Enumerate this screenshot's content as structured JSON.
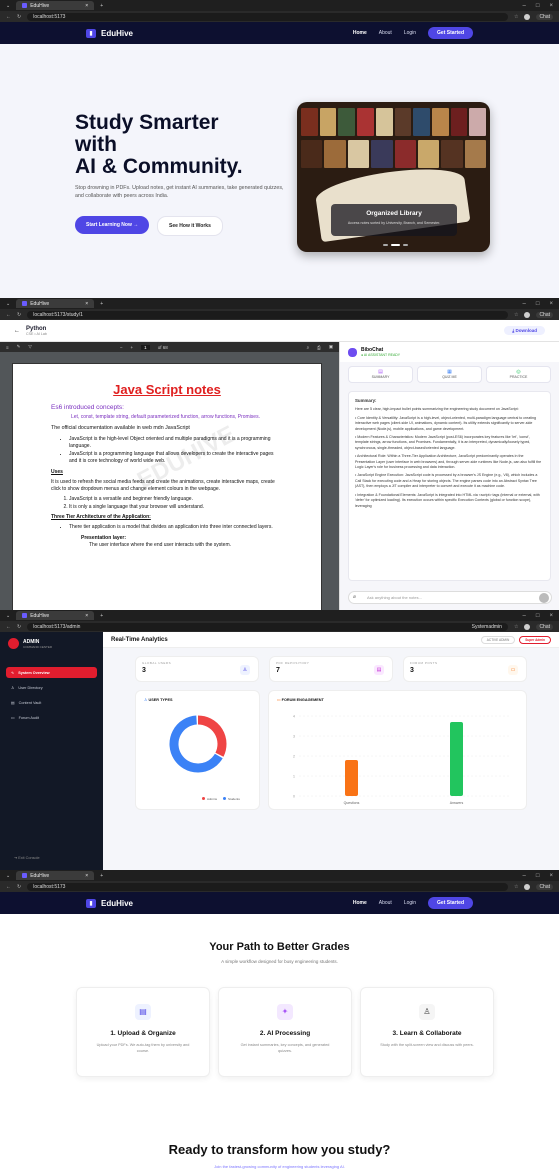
{
  "browser": {
    "tab_title": "EduHive",
    "url_home": "localhost:5173",
    "url_study": "localhost:5173/study/1",
    "url_admin": "localhost:5173/admin",
    "chat_label": "Chat",
    "new_tab": "+"
  },
  "nav": {
    "brand": "EduHive",
    "home": "Home",
    "about": "About",
    "login": "Login",
    "get_started": "Get Started"
  },
  "hero": {
    "title_line1": "Study Smarter",
    "title_line2": "with",
    "title_line3": "AI & Community.",
    "subtitle": "Stop drowning in PDFs. Upload notes, get instant AI summaries, take generated quizzes, and collaborate with peers across India.",
    "cta_primary": "Start Learning Now →",
    "cta_secondary": "See How it Works",
    "card_title": "Organized Library",
    "card_sub": "Access notes sorted by University, Branch, and Semester."
  },
  "study": {
    "doc_title": "Python",
    "doc_meta": "CSE • AI Lab",
    "download": "Download",
    "pdf_page": "1",
    "pdf_total": "of 68",
    "page": {
      "heading": "Java Script notes",
      "es6": "Es6 introduced concepts:",
      "es6_items": "Let, const, template string, default parameterized function, arrow functions, Promises.",
      "doc_line": "The official documentation available in web mdn JavaScript",
      "b1": "JavaScript is the high-level Object oriented and multiple paradigms and it is a programming language.",
      "b2": "JavaScript is a programming language that allows developers to create the interactive pages and it is core technology of world wide web.",
      "uses": "Uses",
      "uses_text": "It is used to refresh the social media feeds and create the animations, create interactive maps, create click to show dropdown menus and change element colours in the webpage.",
      "o1": "JavaScript is a versatile and beginner friendly language.",
      "o2": "It is only a single language that your browser will understand.",
      "arch": "Three Tier Architecture of the Application:",
      "arch1": "There tier application is a model that divides an application into three inter connected layers.",
      "arch2": "Presentation layer:",
      "arch3": "The user interface where the end user interacts with the system."
    },
    "chat": {
      "name": "BiboChat",
      "status": "● AI ASSISTANT READY",
      "mode1": "SUMMARY",
      "mode2": "QUIZ ME",
      "mode3": "PRACTICE",
      "summary_title": "Summary:",
      "intro": "Here are 5 clear, high-impact bullet points summarizing the engineering study document on JavaScript:",
      "p1": "• Core Identity & Versatility: JavaScript is a high-level, object-oriented, multi-paradigm language central to creating interactive web pages (client-side UI, animations, dynamic content). Its utility extends significantly to server-side development (Node.js), mobile applications, and game development.",
      "p2": "• Modern Features & Characteristics: Modern JavaScript (post-ES6) incorporates key features like 'let', 'const', template strings, arrow functions, and Promises. Fundamentally, it is an interpreted, dynamically/loosely typed, synchronous, single-threaded, object-based/oriented language.",
      "p3": "• Architectural Role: Within a Three-Tier Application Architecture, JavaScript predominantly operates in the Presentation Layer (user interface in web browsers) and, through server-side runtimes like Node.js, can also fulfill the Logic Layer's role for business processing and data interaction.",
      "p4": "• JavaScript Engine Execution: JavaScript code is processed by a browser's JS Engine (e.g., V8), which includes a Call Stack for executing code and a Heap for storing objects. The engine parses code into an Abstract Syntax Tree (AST), then employs a JIT compiler and interpreter to convert and execute it as machine code.",
      "p5": "• Integration & Foundational Elements: JavaScript is integrated into HTML via <script> tags (internal or external, with 'defer' for optimized loading). Its execution occurs within specific Execution Contexts (global or function scope), leveraging",
      "placeholder": "Ask anything about the notes..."
    }
  },
  "admin": {
    "brand": "ADMIN",
    "brand_sub": "COMMAND CENTER",
    "nav1": "System Overview",
    "nav2": "User Directory",
    "nav3": "Content Vault",
    "nav4": "Forum Audit",
    "exit": "Exit Console",
    "title": "Real-Time Analytics",
    "system_label": "Systemadmin",
    "pill_active": "ACTIVE ADMIN",
    "pill_super": "Super Admin",
    "stat1_label": "GLOBAL USERS",
    "stat1_value": "3",
    "stat2_label": "PDF REPOSITORY",
    "stat2_value": "7",
    "stat3_label": "FORUM POSTS",
    "stat3_value": "3",
    "donut_title": "USER TYPES",
    "forum_title": "FORUM ENGAGEMENT",
    "legend1": "Admins",
    "legend2": "Students"
  },
  "chart_data": {
    "type": "bar",
    "categories": [
      "Questions",
      "Answers"
    ],
    "values": [
      1.8,
      3.7
    ],
    "ylim": [
      0,
      4
    ],
    "yticks": [
      "0",
      "1",
      "2",
      "3",
      "4"
    ],
    "colors": [
      "#f97316",
      "#22c55e"
    ],
    "donut": {
      "type": "pie",
      "categories": [
        "Admins",
        "Students"
      ],
      "values": [
        1,
        2
      ],
      "colors": [
        "#ef4444",
        "#3b82f6"
      ]
    }
  },
  "how": {
    "title": "Your Path to Better Grades",
    "subtitle": "A simple workflow designed for busy engineering students.",
    "s1_title": "1. Upload & Organize",
    "s1_desc": "Upload your PDFs. We auto-tag them by university and course.",
    "s2_title": "2. AI Processing",
    "s2_desc": "Get instant summaries, key concepts, and generated quizzes.",
    "s3_title": "3. Learn & Collaborate",
    "s3_desc": "Study with the split-screen view and discuss with peers.",
    "ready_title": "Ready to transform how you study?",
    "ready_sub": "Join the fastest-growing community of engineering students leveraging AI."
  },
  "icons": {
    "logo": "book-icon",
    "doc": "file-icon",
    "ai": "sparkle-icon",
    "users": "users-icon"
  }
}
